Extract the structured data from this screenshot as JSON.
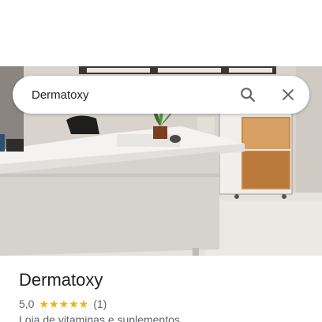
{
  "search": {
    "value": "Dermatoxy",
    "search_icon": "search-icon",
    "close_icon": "close-icon"
  },
  "place": {
    "name": "Dermatoxy",
    "rating": "5,0",
    "stars": "★★★★★",
    "review_count": "(1)",
    "category": "Loja de vitaminas e suplementos"
  },
  "colors": {
    "star": "#f4b400",
    "text_primary": "#202124",
    "text_secondary": "#5f6368"
  }
}
